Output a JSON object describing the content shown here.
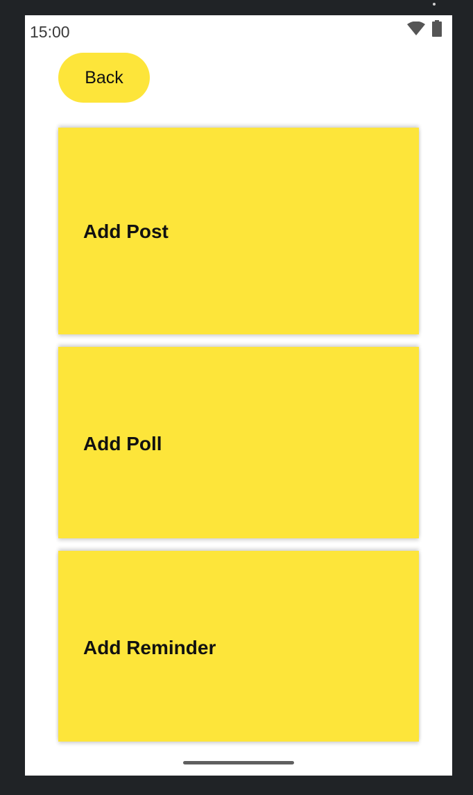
{
  "status_bar": {
    "time": "15:00",
    "icons": [
      "wifi-icon",
      "battery-icon"
    ]
  },
  "header": {
    "back_label": "Back"
  },
  "actions": [
    {
      "label": "Add Post"
    },
    {
      "label": "Add Poll"
    },
    {
      "label": "Add Reminder"
    }
  ],
  "colors": {
    "accent": "#fde53a",
    "text": "#111111",
    "screen_background": "#ffffff",
    "device_frame": "#202326"
  }
}
